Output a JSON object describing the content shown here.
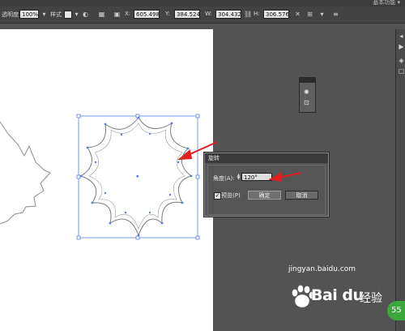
{
  "top_strip": {
    "hint": "基本功能 ▾"
  },
  "control_bar": {
    "stroke_label": "透明度",
    "opacity_value": "100%",
    "style_label": "样式",
    "x_value": "605.498",
    "y_value": "384.524",
    "w_value": "304.432",
    "h_value": "306.576"
  },
  "dialog": {
    "title": "旋转",
    "angle_label": "角度(A):",
    "angle_value": "120°",
    "preview_label": "预览(P)",
    "ok_label": "确定",
    "cancel_label": "取消"
  },
  "watermark": {
    "brand": "Bai du",
    "brand_cn": "经验",
    "url": "jingyan.baidu.com"
  },
  "badge": {
    "text": "55"
  },
  "icons": {
    "dock": [
      "arrow-icon",
      "play-icon",
      "layers-icon",
      "artboard-icon"
    ],
    "mini_panel": [
      "gear-icon",
      "link-icon"
    ]
  },
  "colors": {
    "workspace": "#535353",
    "artboard": "#ffffff",
    "selection": "#5a7fe0",
    "annotation": "#e02020",
    "badge": "#3aa93a"
  }
}
